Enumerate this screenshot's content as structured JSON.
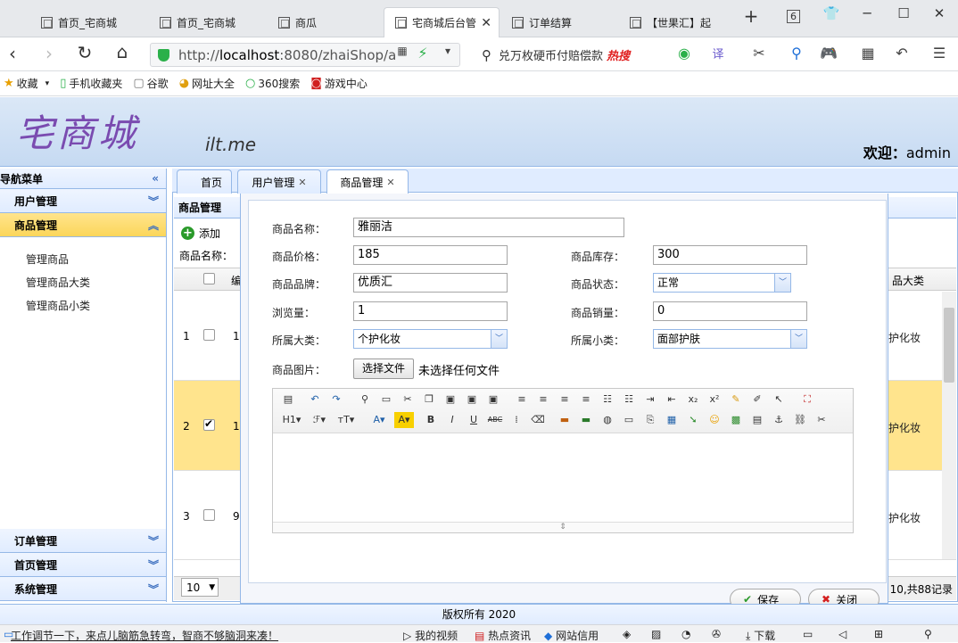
{
  "browser": {
    "tabs": [
      {
        "label": "首页_宅商城"
      },
      {
        "label": "首页_宅商城"
      },
      {
        "label": "商瓜"
      },
      {
        "label": "宅商城后台管"
      },
      {
        "label": "订单结算"
      },
      {
        "label": "【世果汇】起"
      }
    ],
    "new_tab": "+",
    "tab_count": "6",
    "url_prefix": "http://",
    "url_host": "localhost",
    "url_rest": ":8080/zhaiShop/a",
    "search_text": "兑万枚硬币付赔偿款",
    "search_hot": "热搜",
    "bookmarks": [
      {
        "label": "收藏"
      },
      {
        "label": "手机收藏夹"
      },
      {
        "label": "谷歌"
      },
      {
        "label": "网址大全"
      },
      {
        "label": "360搜索"
      },
      {
        "label": "游戏中心"
      }
    ]
  },
  "header": {
    "logo_text": "宅商城",
    "logo_sub": "ilt.me",
    "welcome_label": "欢迎：",
    "welcome_user": "admin"
  },
  "sidebar": {
    "title": "导航菜单",
    "groups": [
      {
        "label": "用户管理"
      },
      {
        "label": "商品管理"
      },
      {
        "label": "订单管理"
      },
      {
        "label": "首页管理"
      },
      {
        "label": "系统管理"
      }
    ],
    "items": [
      {
        "label": "管理商品"
      },
      {
        "label": "管理商品大类"
      },
      {
        "label": "管理商品小类"
      }
    ]
  },
  "main": {
    "tabs": [
      {
        "label": "首页"
      },
      {
        "label": "用户管理"
      },
      {
        "label": "商品管理"
      }
    ],
    "panel_title": "商品管理",
    "add_label": "添加",
    "search_label": "商品名称：",
    "col_id_partial": "编",
    "col_category": "品大类",
    "rows": [
      {
        "num": "1",
        "id": "1",
        "category": "护化妆",
        "checked": false
      },
      {
        "num": "2",
        "id": "1",
        "category": "护化妆",
        "checked": true
      },
      {
        "num": "3",
        "id": "9",
        "category": "护化妆",
        "checked": false
      }
    ],
    "page_size": "10",
    "page_info": "10,共88记录"
  },
  "dialog": {
    "name_label": "商品名称：",
    "name_value": "雅丽洁",
    "price_label": "商品价格：",
    "price_value": "185",
    "stock_label": "商品库存：",
    "stock_value": "300",
    "brand_label": "商品品牌：",
    "brand_value": "优质汇",
    "status_label": "商品状态：",
    "status_value": "正常",
    "views_label": "浏览量：",
    "views_value": "1",
    "sales_label": "商品销量：",
    "sales_value": "0",
    "bigcat_label": "所属大类：",
    "bigcat_value": "个护化妆",
    "smallcat_label": "所属小类：",
    "smallcat_value": "面部护肤",
    "image_label": "商品图片：",
    "file_button": "选择文件",
    "file_text": "未选择任何文件",
    "save_label": "保存",
    "close_label": "关闭"
  },
  "footer": {
    "copyright": "版权所有 2020"
  },
  "statusbar": {
    "left_text": "工作调节一下，来点儿脑筋急转弯，智商不够脑洞来凑！",
    "items": [
      {
        "label": "我的视频"
      },
      {
        "label": "热点资讯"
      },
      {
        "label": "网站信用"
      },
      {
        "label": "下载"
      }
    ]
  }
}
